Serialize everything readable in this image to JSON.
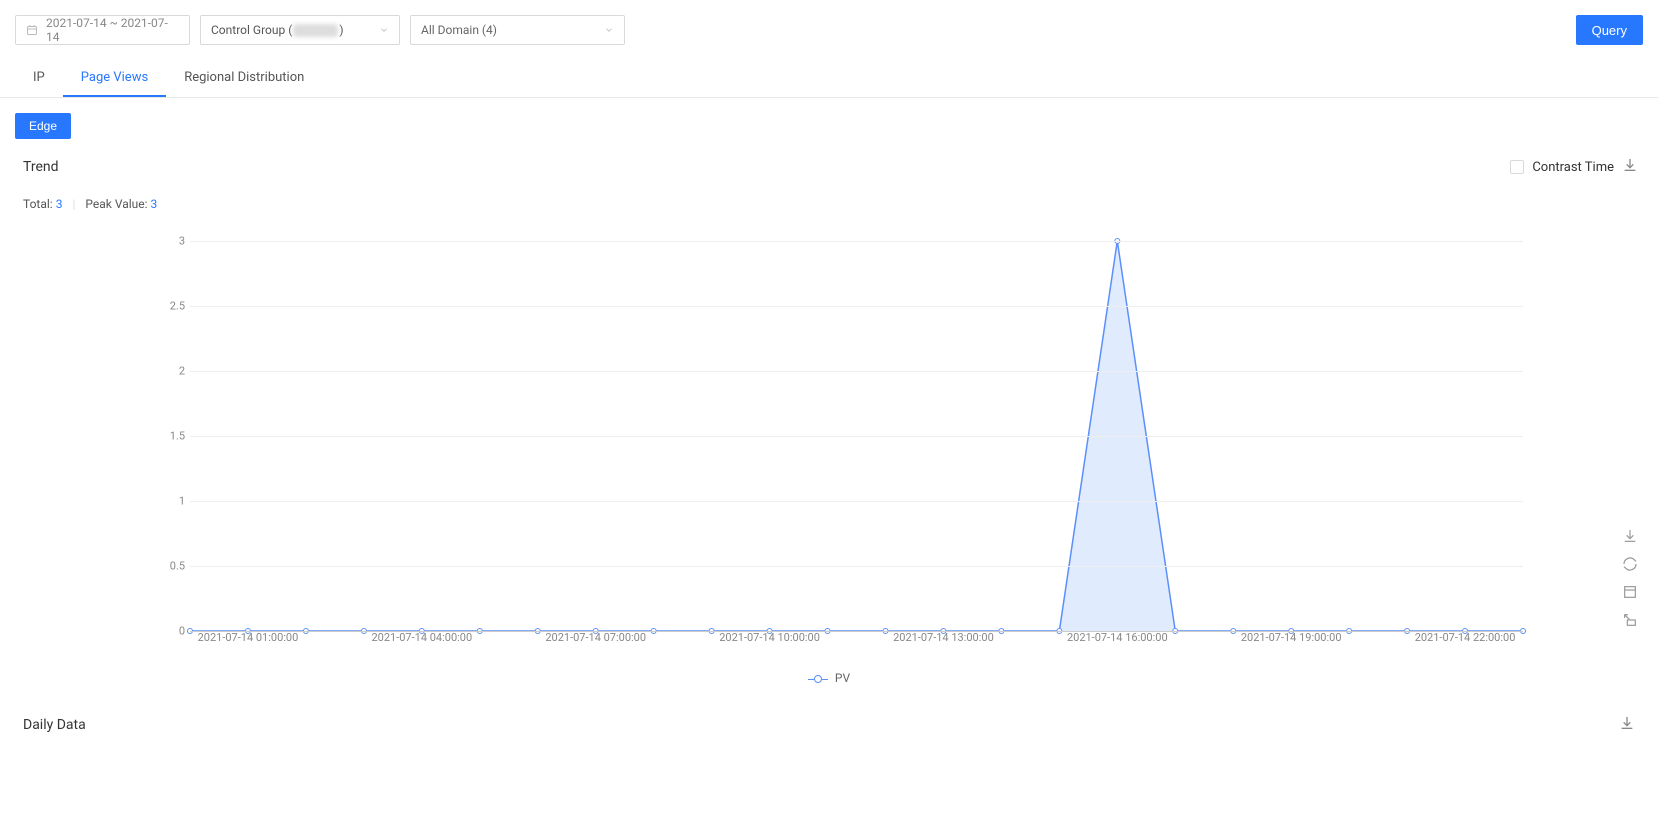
{
  "filters": {
    "date_range": "2021-07-14 ~ 2021-07-14",
    "control_group_prefix": "Control Group (",
    "control_group_suffix": ")",
    "domain": "All Domain (4)",
    "query_button": "Query"
  },
  "tabs": {
    "items": [
      "IP",
      "Page Views",
      "Regional Distribution"
    ],
    "active_index": 1
  },
  "edge_button": "Edge",
  "trend": {
    "title": "Trend",
    "contrast_label": "Contrast Time",
    "total_label": "Total: ",
    "total_value": "3",
    "peak_label": "Peak Value: ",
    "peak_value": "3"
  },
  "legend": {
    "series_name": "PV"
  },
  "daily_data": {
    "title": "Daily Data"
  },
  "chart_data": {
    "type": "area",
    "title": "",
    "xlabel": "",
    "ylabel": "",
    "ylim": [
      0,
      3
    ],
    "y_ticks": [
      0,
      0.5,
      1,
      1.5,
      2,
      2.5,
      3
    ],
    "x_ticks": [
      "2021-07-14 01:00:00",
      "2021-07-14 04:00:00",
      "2021-07-14 07:00:00",
      "2021-07-14 10:00:00",
      "2021-07-14 13:00:00",
      "2021-07-14 16:00:00",
      "2021-07-14 19:00:00",
      "2021-07-14 22:00:00"
    ],
    "x": [
      "2021-07-14 00:00:00",
      "2021-07-14 01:00:00",
      "2021-07-14 02:00:00",
      "2021-07-14 03:00:00",
      "2021-07-14 04:00:00",
      "2021-07-14 05:00:00",
      "2021-07-14 06:00:00",
      "2021-07-14 07:00:00",
      "2021-07-14 08:00:00",
      "2021-07-14 09:00:00",
      "2021-07-14 10:00:00",
      "2021-07-14 11:00:00",
      "2021-07-14 12:00:00",
      "2021-07-14 13:00:00",
      "2021-07-14 14:00:00",
      "2021-07-14 15:00:00",
      "2021-07-14 16:00:00",
      "2021-07-14 17:00:00",
      "2021-07-14 18:00:00",
      "2021-07-14 19:00:00",
      "2021-07-14 20:00:00",
      "2021-07-14 21:00:00",
      "2021-07-14 22:00:00",
      "2021-07-14 23:00:00"
    ],
    "series": [
      {
        "name": "PV",
        "values": [
          0,
          0,
          0,
          0,
          0,
          0,
          0,
          0,
          0,
          0,
          0,
          0,
          0,
          0,
          0,
          0,
          3,
          0,
          0,
          0,
          0,
          0,
          0,
          0
        ]
      }
    ]
  }
}
